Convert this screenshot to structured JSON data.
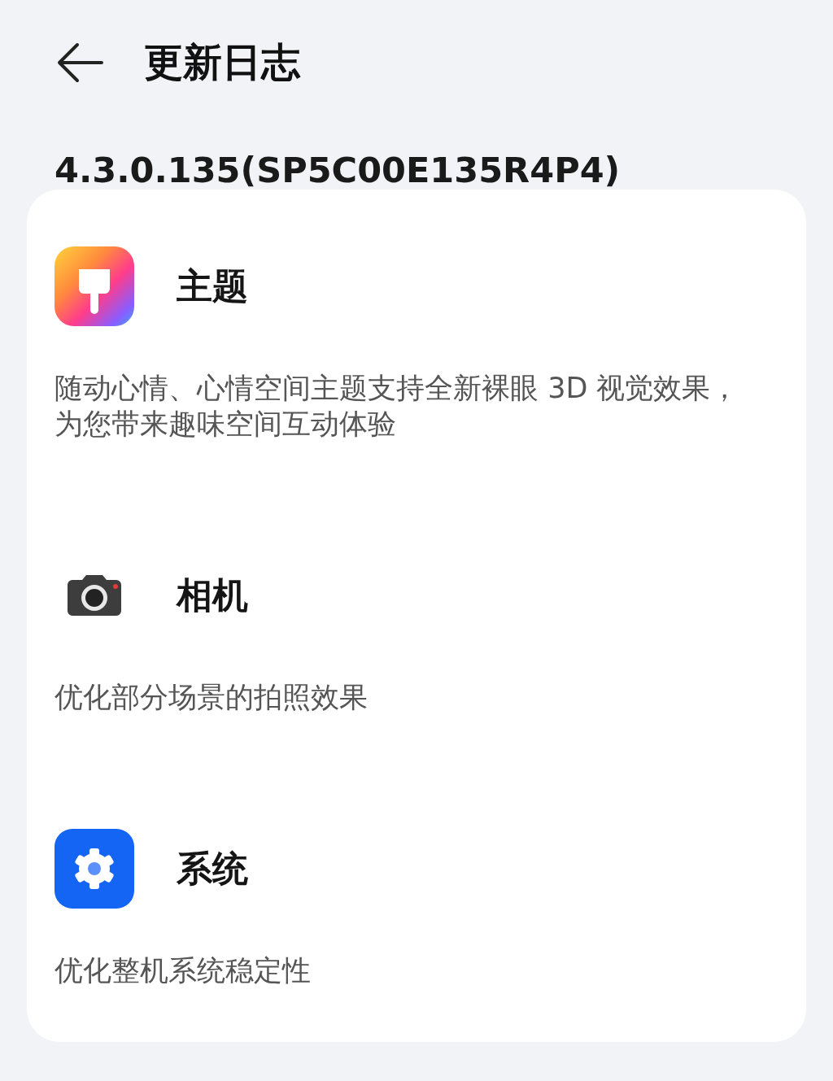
{
  "header": {
    "title": "更新日志"
  },
  "version": "4.3.0.135(SP5C00E135R4P4)",
  "items": [
    {
      "kind": "theme",
      "title": "主题",
      "description": "随动心情、心情空间主题支持全新裸眼 3D 视觉效果，为您带来趣味空间互动体验"
    },
    {
      "kind": "camera",
      "title": "相机",
      "description": "优化部分场景的拍照效果"
    },
    {
      "kind": "system",
      "title": "系统",
      "description": "优化整机系统稳定性"
    }
  ]
}
